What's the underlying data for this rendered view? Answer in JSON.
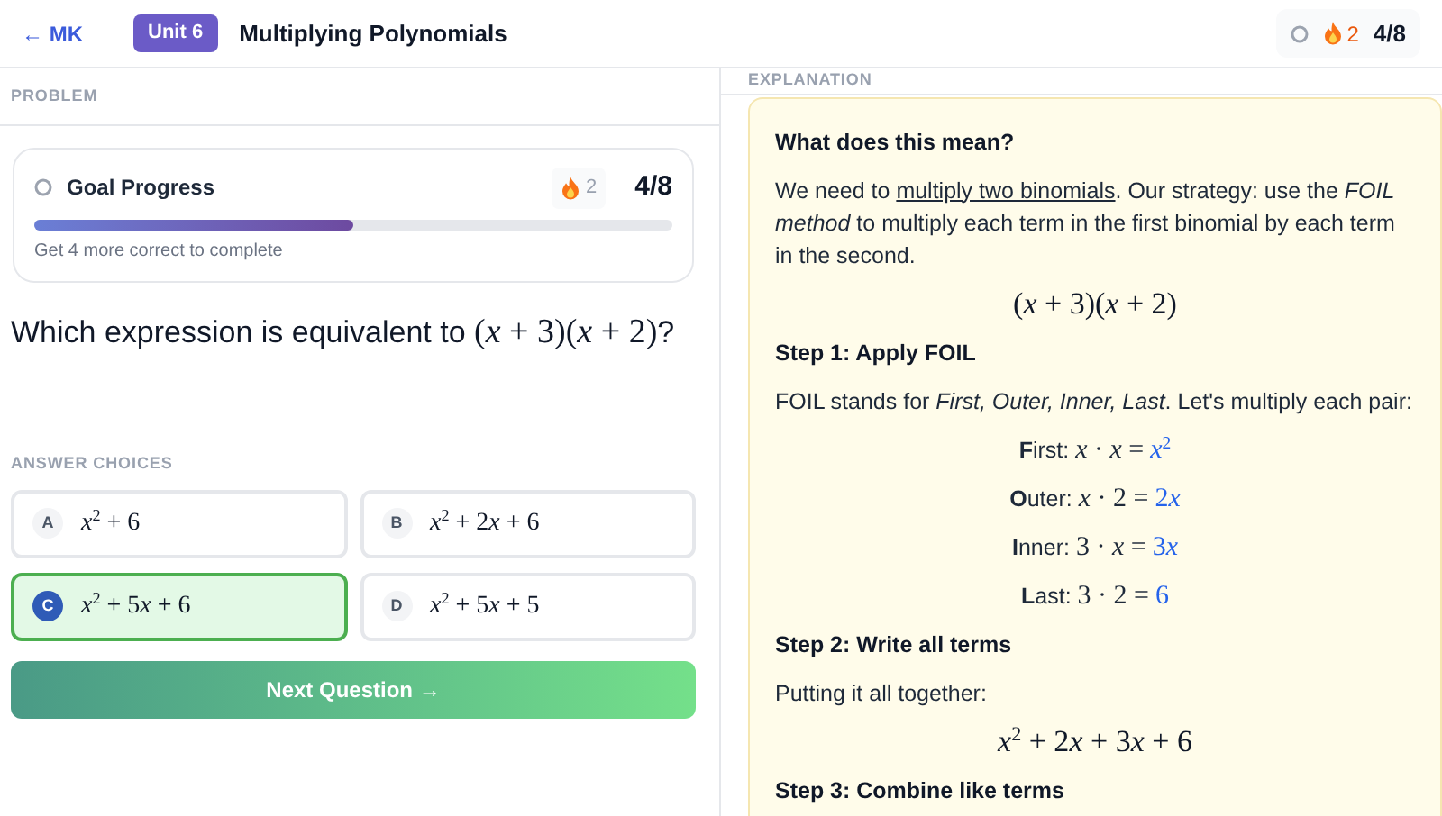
{
  "header": {
    "back": "← MK",
    "unit_badge": "Unit 6",
    "title": "Multiplying Polynomials",
    "streak": "2",
    "score": "4/8"
  },
  "problem": {
    "section_label": "PROBLEM",
    "goal": {
      "title": "Goal Progress",
      "streak": "2",
      "score": "4/8",
      "level": 0.5,
      "hint": "Get 4 more correct to complete"
    },
    "question": {
      "prefix": "Which expression is equivalent to ",
      "math": "(x + 3)(x + 2)",
      "suffix": "?"
    },
    "choices_label": "ANSWER CHOICES",
    "choices": [
      {
        "letter": "A",
        "math": "x$^{2}$ + 6",
        "selected": false
      },
      {
        "letter": "B",
        "math": "x$^{2}$ + 2x + 6",
        "selected": false
      },
      {
        "letter": "C",
        "math": "x$^{2}$ + 5x + 6",
        "selected": true
      },
      {
        "letter": "D",
        "math": "x$^{2}$ + 5x + 5",
        "selected": false
      }
    ],
    "next_button": "Next Question →"
  },
  "explanation": {
    "section_label": "EXPLANATION",
    "blocks": [
      {
        "kind": "heading",
        "text": "What does this mean?"
      },
      {
        "kind": "paragraph_link",
        "before": "We need to ",
        "link": "multiply two binomials",
        "after": ". Our strategy: use the *FOIL method* to multiply each term in the first binomial by each term in the second."
      },
      {
        "kind": "math",
        "text": "(x + 3)(x + 2)"
      },
      {
        "kind": "heading",
        "text": "Step 1: Apply FOIL"
      },
      {
        "kind": "paragraph",
        "text": "FOIL stands for *First, Outer, Inner, Last*. Let's multiply each pair:"
      },
      {
        "kind": "foil",
        "label": "**F**irst:",
        "math": "x · x =",
        "result": "x$^{2}$"
      },
      {
        "kind": "foil",
        "label": "**O**uter:",
        "math": "x · 2 =",
        "result": "2x"
      },
      {
        "kind": "foil",
        "label": "**I**nner:",
        "math": "3 · x =",
        "result": "3x"
      },
      {
        "kind": "foil",
        "label": "**L**ast:",
        "math": "3 · 2 =",
        "result": "6"
      },
      {
        "kind": "heading",
        "text": "Step 2: Write all terms"
      },
      {
        "kind": "paragraph",
        "text": "Putting it all together:"
      },
      {
        "kind": "math",
        "text": "x$^{2}$ + 2x + 3x + 6"
      },
      {
        "kind": "heading",
        "text": "Step 3: Combine like terms"
      }
    ]
  }
}
